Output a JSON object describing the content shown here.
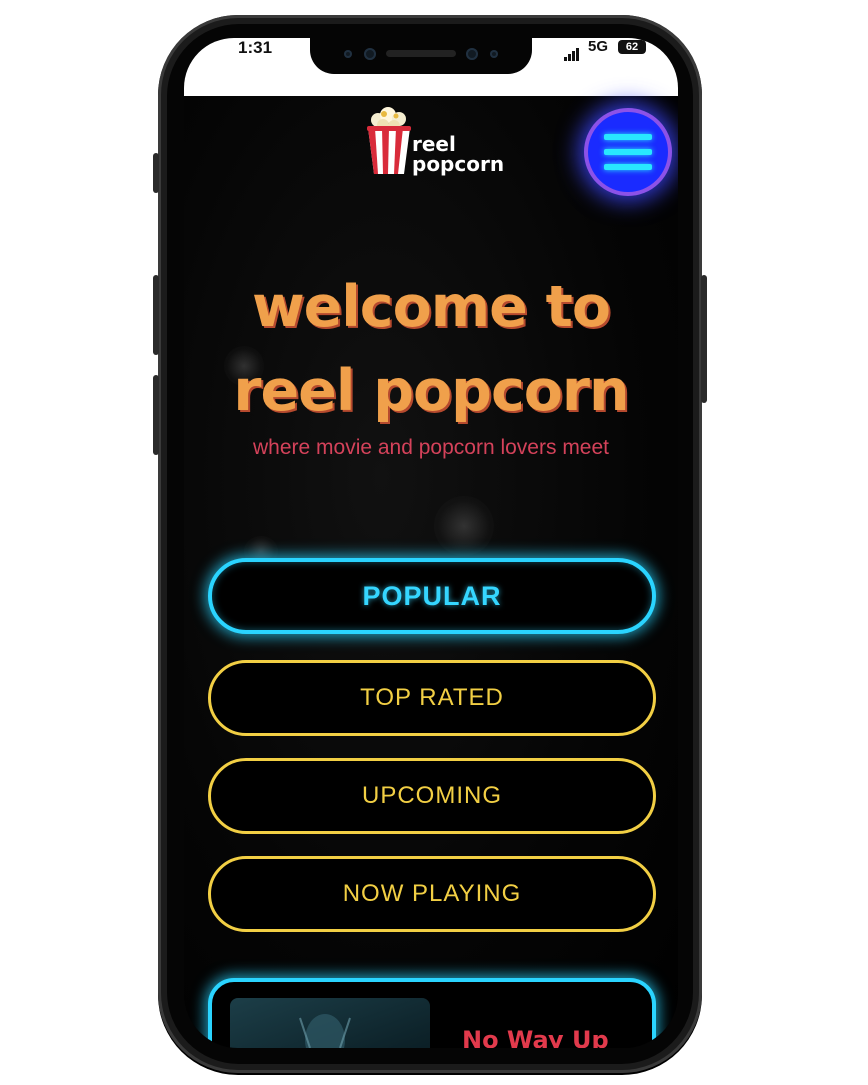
{
  "status_bar": {
    "time": "1:31",
    "network": "5G",
    "battery": "62"
  },
  "logo": {
    "line1": "reel",
    "line2": "popcorn"
  },
  "hero": {
    "line1": "welcome to",
    "line2": "reel popcorn",
    "tagline": "where movie and popcorn lovers meet"
  },
  "categories": [
    {
      "label": "POPULAR",
      "active": true
    },
    {
      "label": "TOP RATED",
      "active": false
    },
    {
      "label": "UPCOMING",
      "active": false
    },
    {
      "label": "NOW PLAYING",
      "active": false
    }
  ],
  "movie_card": {
    "title": "No Way Up"
  },
  "colors": {
    "headline": "#f0a04b",
    "tagline": "#d4425a",
    "neon_cyan": "#2ad4ff",
    "neon_yellow": "#f2cf44",
    "menu_button": "#1a2bff",
    "movie_title": "#e23a4c"
  },
  "icons": {
    "menu": "hamburger-icon",
    "logo": "popcorn-bucket-icon"
  }
}
